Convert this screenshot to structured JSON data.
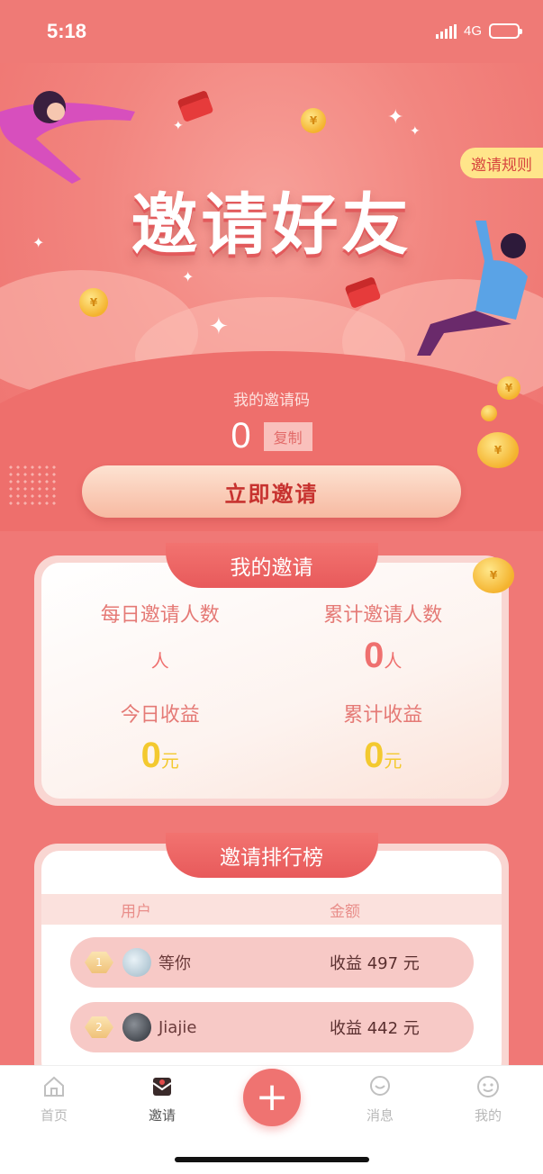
{
  "status": {
    "time": "5:18",
    "network": "4G"
  },
  "hero": {
    "title": "邀请好友",
    "rules": "邀请规则"
  },
  "invite_code": {
    "label": "我的邀请码",
    "value": "0",
    "copy": "复制"
  },
  "invite_button": "立即邀请",
  "my_invite": {
    "title": "我的邀请",
    "daily_label": "每日邀请人数",
    "daily_value": "",
    "daily_unit": "人",
    "total_label": "累计邀请人数",
    "total_value": "0",
    "total_unit": "人",
    "today_income_label": "今日收益",
    "today_income_value": "0",
    "today_income_unit": "元",
    "total_income_label": "累计收益",
    "total_income_value": "0",
    "total_income_unit": "元"
  },
  "ranking": {
    "title": "邀请排行榜",
    "col_user": "用户",
    "col_amount": "金额",
    "rows": [
      {
        "rank": "1",
        "name": "等你",
        "amount": "收益 497 元"
      },
      {
        "rank": "2",
        "name": "Jiajie",
        "amount": "收益 442 元"
      }
    ]
  },
  "tabbar": {
    "home": "首页",
    "invite": "邀请",
    "messages": "消息",
    "mine": "我的",
    "add": "+"
  },
  "colors": {
    "primary": "#ef7371",
    "gold": "#f3c92f",
    "accent_text": "#c7322f"
  }
}
